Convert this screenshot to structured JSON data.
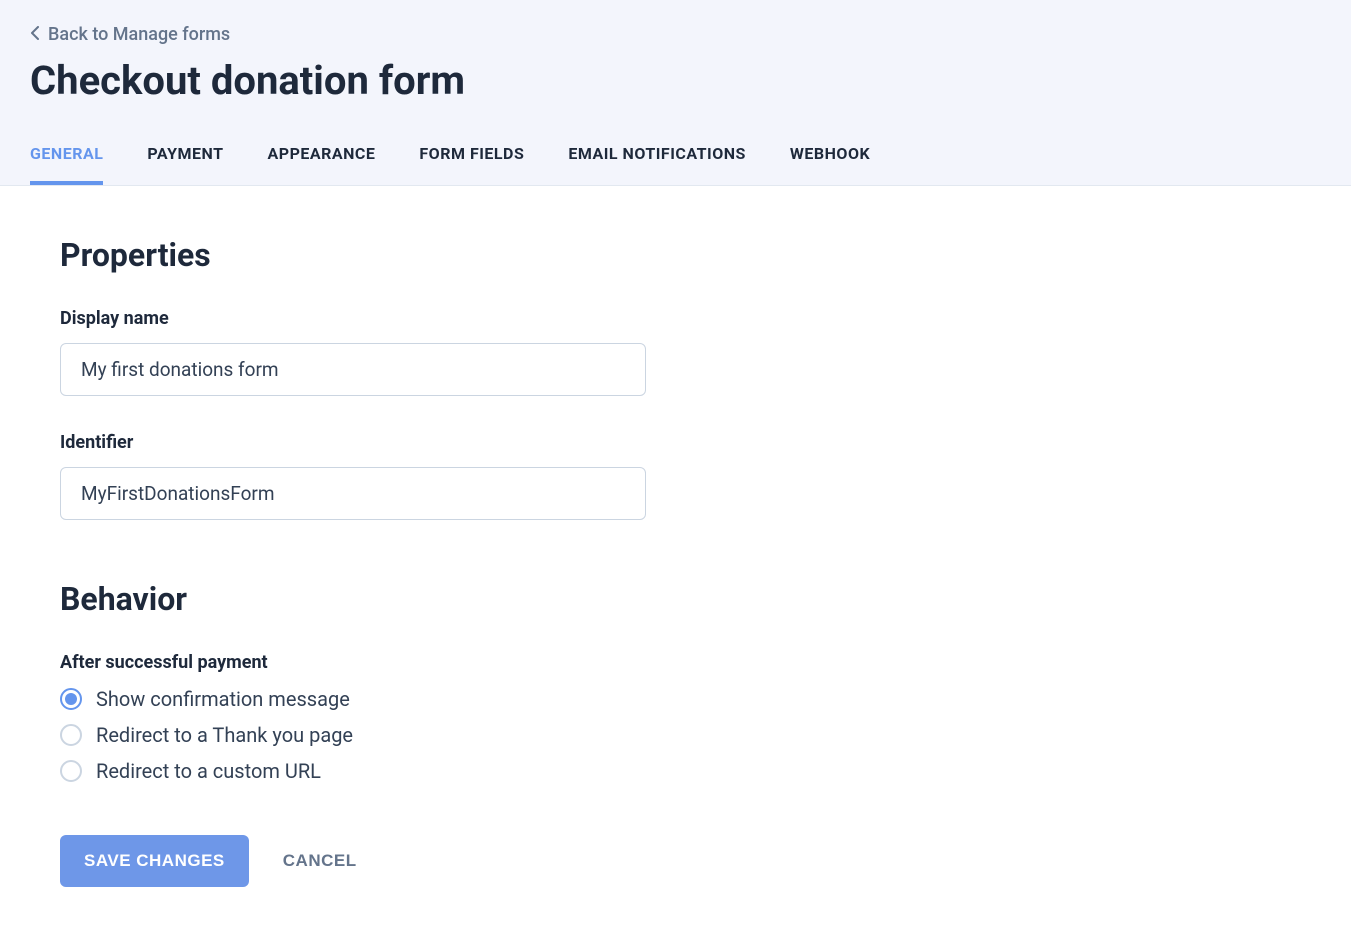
{
  "header": {
    "back_label": "Back to Manage forms",
    "page_title": "Checkout donation form"
  },
  "tabs": [
    {
      "label": "General",
      "active": true
    },
    {
      "label": "Payment",
      "active": false
    },
    {
      "label": "Appearance",
      "active": false
    },
    {
      "label": "Form fields",
      "active": false
    },
    {
      "label": "Email notifications",
      "active": false
    },
    {
      "label": "Webhook",
      "active": false
    }
  ],
  "sections": {
    "properties": {
      "title": "Properties",
      "display_name": {
        "label": "Display name",
        "value": "My first donations form"
      },
      "identifier": {
        "label": "Identifier",
        "value": "MyFirstDonationsForm"
      }
    },
    "behavior": {
      "title": "Behavior",
      "after_payment": {
        "label": "After successful payment",
        "options": [
          {
            "label": "Show confirmation message",
            "selected": true
          },
          {
            "label": "Redirect to a Thank you page",
            "selected": false
          },
          {
            "label": "Redirect to a custom URL",
            "selected": false
          }
        ]
      }
    }
  },
  "actions": {
    "save": "Save changes",
    "cancel": "Cancel"
  }
}
